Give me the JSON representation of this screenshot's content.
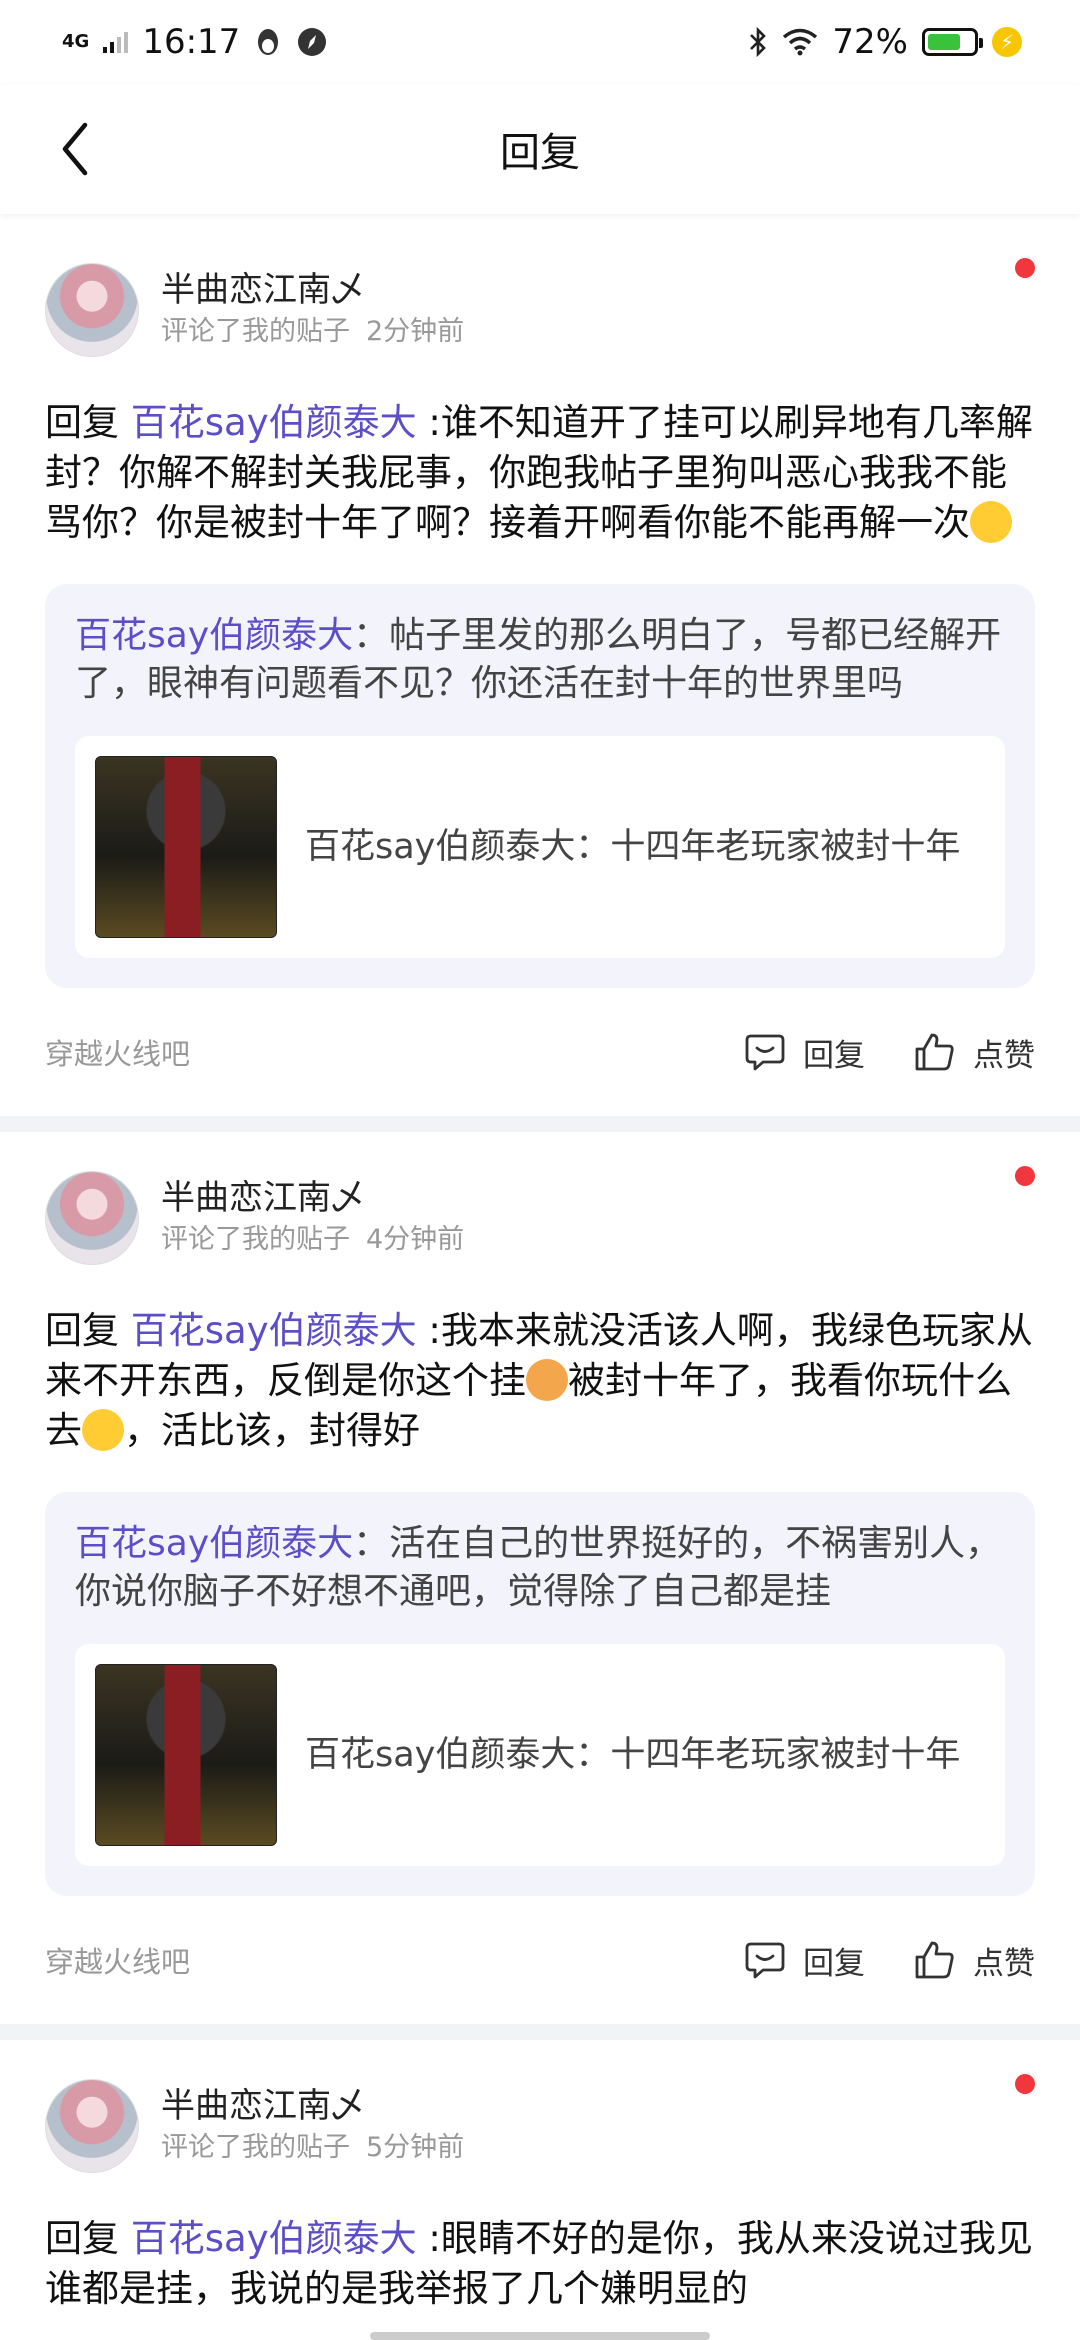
{
  "status_bar": {
    "network": "4G",
    "time": "16:17",
    "battery_percent": "72%",
    "battery_level": 0.72
  },
  "header": {
    "title": "回复",
    "back_icon": "chevron-left-icon"
  },
  "notifications": [
    {
      "username": "半曲恋江南乄",
      "action": "评论了我的贴子",
      "time": "2分钟前",
      "reply_prefix": "回复",
      "mention": "百花say伯颜泰大",
      "text": ":谁不知道开了挂可以刷异地有几率解封？你解不解封关我屁事，你跑我帖子里狗叫恶心我我不能骂你？你是被封十年了啊？接着开啊看你能不能再解一次",
      "quote_author": "百花say伯颜泰大",
      "quote_text": "：帖子里发的那么明白了，号都已经解开了，眼神有问题看不见？你还活在封十年的世界里吗",
      "thread_title": "百花say伯颜泰大：十四年老玩家被封十年",
      "forum": "穿越火线吧",
      "reply_label": "回复",
      "like_label": "点赞"
    },
    {
      "username": "半曲恋江南乄",
      "action": "评论了我的贴子",
      "time": "4分钟前",
      "reply_prefix": "回复",
      "mention": "百花say伯颜泰大",
      "text_a": ":我本来就没活该人啊，我绿色玩家从来不开东西，反倒是你这个挂",
      "text_b": "被封十年了，我看你玩什么去",
      "text_c": "，活比该，封得好",
      "quote_author": "百花say伯颜泰大",
      "quote_text": "：活在自己的世界挺好的，不祸害别人，你说你脑子不好想不通吧，觉得除了自己都是挂",
      "thread_title": "百花say伯颜泰大：十四年老玩家被封十年",
      "forum": "穿越火线吧",
      "reply_label": "回复",
      "like_label": "点赞"
    },
    {
      "username": "半曲恋江南乄",
      "action": "评论了我的贴子",
      "time": "5分钟前",
      "reply_prefix": "回复",
      "mention": "百花say伯颜泰大",
      "text": ":眼睛不好的是你，我从来没说过我见谁都是挂，我说的是我举报了几个嫌明显的"
    }
  ],
  "colors": {
    "mention": "#5c4ec8",
    "unread_dot": "#f0373d",
    "quote_bg": "#f3f3fc"
  }
}
